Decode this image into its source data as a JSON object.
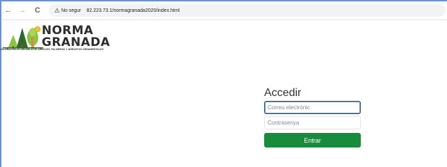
{
  "browser": {
    "nav": {
      "back_icon": "←",
      "forward_icon": "→",
      "reload_icon": "C"
    },
    "security": {
      "icon": "⚠",
      "label": "No segur"
    },
    "url": "82.223.73.1/normagranada2020/index.html"
  },
  "logo": {
    "word1": "NORMA",
    "word2": "GRANADA",
    "tagline": "VALORACIÓN ECONÓMICA DE ÁRBOLES, PALMERAS Y ARBUSTOS ORNAMENTALES",
    "colors": {
      "tree_dark": "#2e6b2a",
      "tree_light": "#8cc63f",
      "trunk": "#7a5a2b",
      "text": "#2d2d2d"
    }
  },
  "login": {
    "title": "Accedir",
    "email_placeholder": "Correu electrònic",
    "password_placeholder": "Contrasenya",
    "submit_label": "Entrar",
    "submit_color": "#198b3c"
  }
}
